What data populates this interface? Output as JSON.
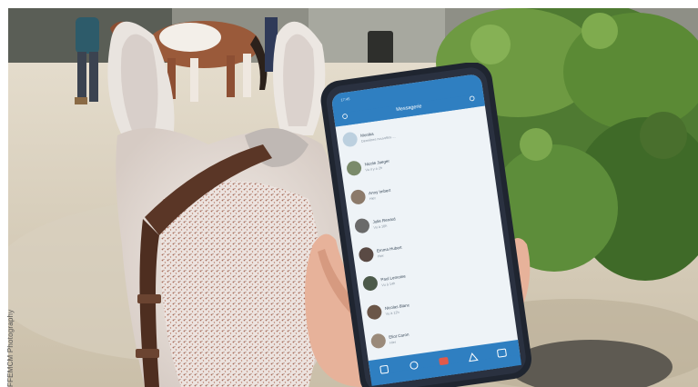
{
  "photo_credit": "FFEMCM Photography",
  "phone_app": {
    "header_title": "Messagerie",
    "status_time": "17:45",
    "rows": [
      {
        "name": "Monika",
        "sub": "Dernières nouvelles ..."
      },
      {
        "name": "Nicole Jaeger",
        "sub": "Vu il y a 2h"
      },
      {
        "name": "Anny Imbert",
        "sub": "Hier"
      },
      {
        "name": "Julie Renard",
        "sub": "Vu à 18h"
      },
      {
        "name": "Emma Hubert",
        "sub": "Hier"
      },
      {
        "name": "Paul Lemoine",
        "sub": "Vu à 14h"
      },
      {
        "name": "Nicolas Blanc",
        "sub": "Vu à 12h"
      },
      {
        "name": "Eliot Caron",
        "sub": "Hier"
      }
    ],
    "tabbar_icons": [
      "home-icon",
      "chat-icon",
      "camera-icon",
      "horse-icon",
      "settings-icon"
    ]
  },
  "colors": {
    "app_blue": "#2f7fc1",
    "screen_bg": "#eef3f7",
    "tab_accent": "#e05a4c"
  }
}
